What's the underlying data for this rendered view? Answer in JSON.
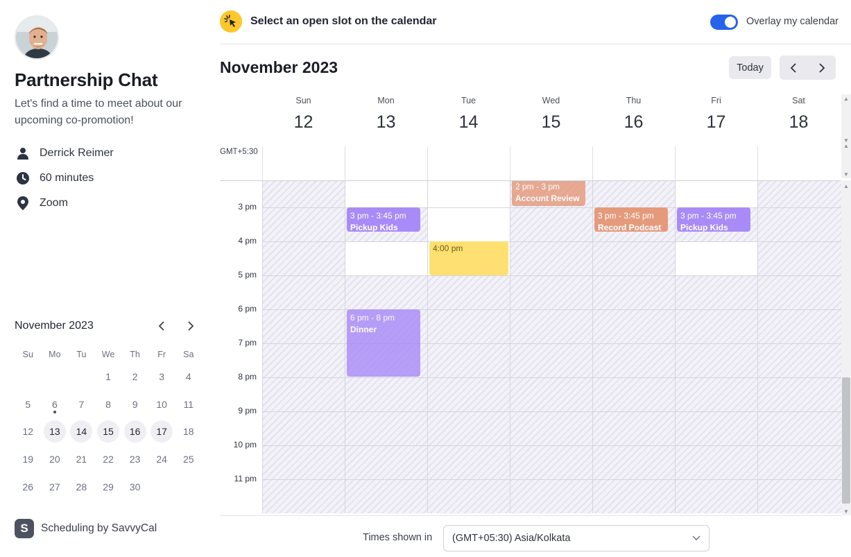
{
  "sidebar": {
    "title": "Partnership Chat",
    "description": "Let's find a time to meet about our upcoming co-promotion!",
    "host": "Derrick Reimer",
    "duration": "60 minutes",
    "location": "Zoom",
    "icons": {
      "host": "person-icon",
      "duration": "clock-icon",
      "location": "map-pin-icon"
    },
    "mini_calendar": {
      "month_label": "November 2023",
      "weekdays": [
        "Su",
        "Mo",
        "Tu",
        "We",
        "Th",
        "Fr",
        "Sa"
      ],
      "weeks": [
        [
          "",
          "",
          "",
          "1",
          "2",
          "3",
          "4"
        ],
        [
          "5",
          "6",
          "7",
          "8",
          "9",
          "10",
          "11"
        ],
        [
          "12",
          "13",
          "14",
          "15",
          "16",
          "17",
          "18"
        ],
        [
          "19",
          "20",
          "21",
          "22",
          "23",
          "24",
          "25"
        ],
        [
          "26",
          "27",
          "28",
          "29",
          "30",
          "",
          ""
        ]
      ],
      "today": "6",
      "available_days": [
        "13",
        "14",
        "15",
        "16",
        "17"
      ]
    },
    "brand": {
      "logo_letter": "S",
      "label": "Scheduling by SavvyCal"
    }
  },
  "topbar": {
    "hint": "Select an open slot on the calendar",
    "overlay_label": "Overlay my calendar",
    "overlay_on": true,
    "accent": "#2563eb"
  },
  "calendar": {
    "month_label": "November 2023",
    "today_label": "Today",
    "timezone_short": "GMT+5:30",
    "days": [
      {
        "name": "Sun",
        "date": "12"
      },
      {
        "name": "Mon",
        "date": "13"
      },
      {
        "name": "Tue",
        "date": "14"
      },
      {
        "name": "Wed",
        "date": "15"
      },
      {
        "name": "Thu",
        "date": "16"
      },
      {
        "name": "Fri",
        "date": "17"
      },
      {
        "name": "Sat",
        "date": "18"
      }
    ],
    "hours": [
      "3 pm",
      "4 pm",
      "5 pm",
      "6 pm",
      "7 pm",
      "8 pm",
      "9 pm",
      "10 pm",
      "11 pm"
    ],
    "events": [
      {
        "time": "2 pm - 3 pm",
        "title": "Account Review",
        "color": "orange"
      },
      {
        "time": "3 pm - 3:45 pm",
        "title": "Pickup Kids",
        "color": "purple"
      },
      {
        "time": "3 pm - 3:45 pm",
        "title": "Record Podcast",
        "color": "orange"
      },
      {
        "time": "3 pm - 3:45 pm",
        "title": "Pickup Kids",
        "color": "purple"
      },
      {
        "time": "6 pm - 8 pm",
        "title": "Dinner",
        "color": "purple"
      },
      {
        "time": "4:00 pm",
        "title": "",
        "color": "yellow"
      }
    ],
    "colors": {
      "purple": "#a98bf7",
      "orange": "#e59a7c",
      "yellow": "#fde071"
    }
  },
  "footer": {
    "times_label": "Times shown in",
    "timezone": "(GMT+05:30) Asia/Kolkata"
  }
}
